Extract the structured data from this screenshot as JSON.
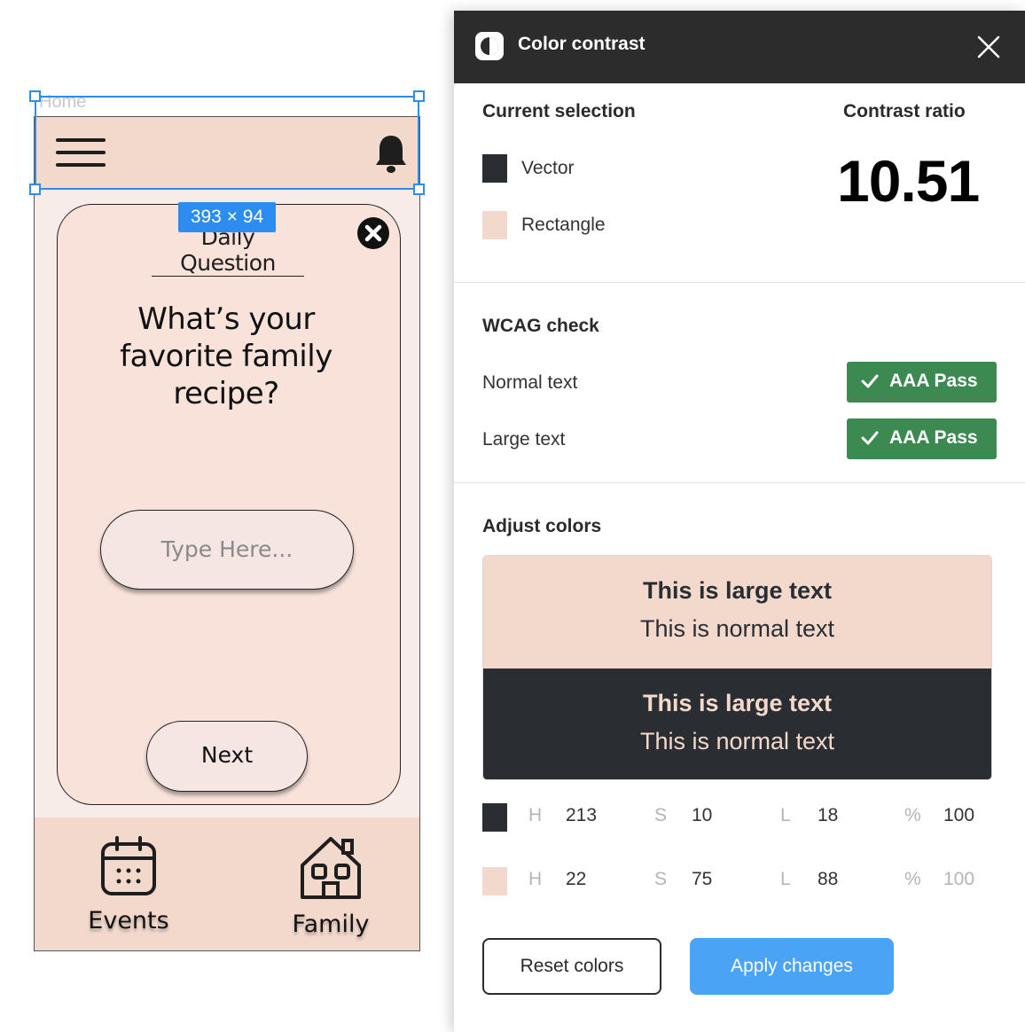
{
  "canvas": {
    "frame_label": "Home",
    "selection_size": "393 × 94",
    "card": {
      "title": "Daily Question",
      "question": "What’s your favorite family recipe?",
      "input_placeholder": "Type Here...",
      "next_label": "Next"
    },
    "nav": {
      "events_label": "Events",
      "family_label": "Family"
    }
  },
  "panel": {
    "title": "Color contrast",
    "current_selection_label": "Current selection",
    "contrast_ratio_label": "Contrast ratio",
    "contrast_ratio_value": "10.51",
    "layers": [
      {
        "name": "Vector",
        "color": "#2a2e33"
      },
      {
        "name": "Rectangle",
        "color": "#f3d9cc"
      }
    ],
    "wcag": {
      "heading": "WCAG check",
      "normal_label": "Normal text",
      "normal_result": "AAA Pass",
      "large_label": "Large text",
      "large_result": "AAA Pass",
      "pass_color": "#3c8a52"
    },
    "adjust": {
      "heading": "Adjust colors",
      "preview_large": "This is large text",
      "preview_normal": "This is normal text"
    },
    "hsl": [
      {
        "h_key": "H",
        "h": "213",
        "s_key": "S",
        "s": "10",
        "l_key": "L",
        "l": "18",
        "pct_key": "%",
        "pct": "100",
        "color": "#2a2e33"
      },
      {
        "h_key": "H",
        "h": "22",
        "s_key": "S",
        "s": "75",
        "l_key": "L",
        "l": "88",
        "pct_key": "%",
        "pct": "100",
        "color": "#f3d9cc"
      }
    ],
    "reset_label": "Reset colors",
    "apply_label": "Apply changes",
    "accent_color": "#4aa3f5"
  }
}
